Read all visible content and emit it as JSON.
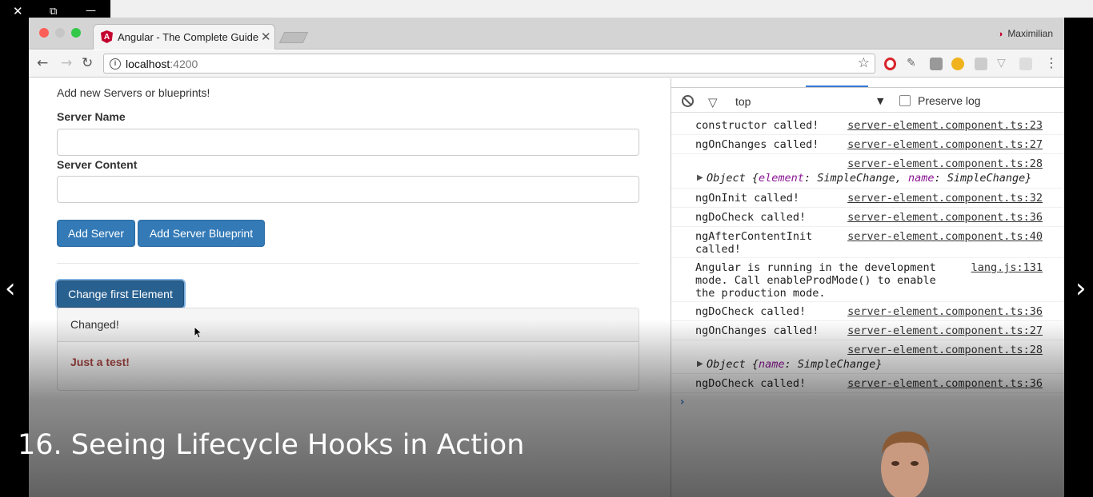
{
  "player": {
    "close_glyph": "✕",
    "restore_glyph": "⧉",
    "minimize_glyph": "—",
    "prev_glyph": "‹",
    "next_glyph": "›",
    "lecture_title": "16. Seeing Lifecycle Hooks in Action"
  },
  "browser": {
    "tab_title": "Angular - The Complete Guide",
    "tab_close": "✕",
    "profile_name": "Maximilian",
    "url_host": "localhost",
    "url_port": ":4200",
    "colors": {
      "angular_red": "#c3002f",
      "tab_bar": "#d4d4d4"
    }
  },
  "page": {
    "intro": "Add new Servers or blueprints!",
    "server_name_label": "Server Name",
    "server_name_value": "",
    "server_content_label": "Server Content",
    "server_content_value": "",
    "add_server_button": "Add Server",
    "add_blueprint_button": "Add Server Blueprint",
    "change_first_button": "Change first Element",
    "panel_heading": "Changed!",
    "panel_body": "Just a test!",
    "colors": {
      "primary": "#337ab7",
      "danger_text": "#a94442"
    }
  },
  "devtools": {
    "context": "top",
    "preserve_log_label": "Preserve log",
    "preserve_log_checked": false,
    "logs": [
      {
        "message": "constructor called!",
        "source": "server-element.component.ts:23"
      },
      {
        "message": "ngOnChanges called!",
        "source": "server-element.component.ts:27"
      },
      {
        "message": "",
        "source": "server-element.component.ts:28"
      },
      {
        "message": "ngOnInit called!",
        "source": "server-element.component.ts:32"
      },
      {
        "message": "ngDoCheck called!",
        "source": "server-element.component.ts:36"
      },
      {
        "message": "ngAfterContentInit called!",
        "source": "server-element.component.ts:40"
      },
      {
        "message": "Angular is running in the development mode. Call enableProdMode() to enable the production mode.",
        "source": "lang.js:131"
      },
      {
        "message": "ngDoCheck called!",
        "source": "server-element.component.ts:36"
      },
      {
        "message": "ngOnChanges called!",
        "source": "server-element.component.ts:27"
      },
      {
        "message": "",
        "source": "server-element.component.ts:28"
      },
      {
        "message": "ngDoCheck called!",
        "source": "server-element.component.ts:36"
      }
    ],
    "object_1": {
      "prefix": "Object {",
      "key1": "element",
      "val1": ": SimpleChange, ",
      "key2": "name",
      "val2": ": SimpleChange}"
    },
    "object_2": {
      "prefix": "Object {",
      "key1": "name",
      "val1": ": SimpleChange}"
    },
    "prompt_glyph": "›"
  }
}
